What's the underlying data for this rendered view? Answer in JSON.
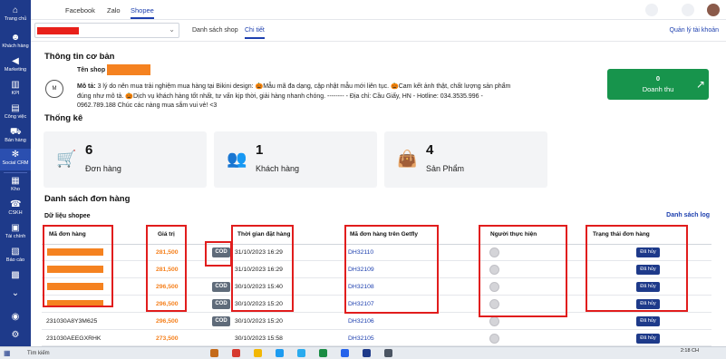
{
  "sidebar": {
    "items": [
      {
        "label": "Trang chủ",
        "icon": "home-icon"
      },
      {
        "label": "Khách hàng",
        "icon": "customers-icon"
      },
      {
        "label": "Marketing",
        "icon": "megaphone-icon"
      },
      {
        "label": "KPI",
        "icon": "chart-icon"
      },
      {
        "label": "Công việc",
        "icon": "briefcase-icon"
      },
      {
        "label": "Bán hàng",
        "icon": "cart-icon"
      },
      {
        "label": "Social CRM",
        "icon": "social-icon"
      },
      {
        "label": "Kho",
        "icon": "warehouse-icon"
      },
      {
        "label": "CSKH",
        "icon": "support-icon"
      },
      {
        "label": "Tài chính",
        "icon": "finance-icon"
      },
      {
        "label": "Báo cáo",
        "icon": "report-icon"
      }
    ]
  },
  "topbar": {
    "tabs": [
      "Facebook",
      "Zalo",
      "Shopee"
    ],
    "active_tab": "Shopee"
  },
  "subbar": {
    "tabs": [
      "Danh sách shop",
      "Chi tiết"
    ],
    "account_link": "Quản lý tài khoản"
  },
  "info": {
    "section_title": "Thông tin cơ bản",
    "shop_label": "Tên shop",
    "desc_label": "Mô tả:",
    "desc_text": "3 lý do nên mua trải nghiệm mua hàng tại Bikini design: 🎃Mẫu mã đa dạng, cập nhật mẫu mới liên tục. 🎃Cam kết ảnh thật, chất lượng sản phẩm đúng như mô tả. 🎃Dịch vụ khách hàng tốt nhất, tư vấn kịp thời, giải hàng nhanh chóng. -------- - Địa chỉ: Cầu Giấy, HN - Hotline: 034.3535.996 - 0962.789.188 Chúc các nàng mua sắm vui vẻ! <3"
  },
  "revenue": {
    "value": "0",
    "label": "Doanh thu"
  },
  "stats": {
    "section_title": "Thống kê",
    "cards": [
      {
        "value": "6",
        "label": "Đơn hàng",
        "icon": "cart-icon"
      },
      {
        "value": "1",
        "label": "Khách hàng",
        "icon": "users-icon"
      },
      {
        "value": "4",
        "label": "Sản Phẩm",
        "icon": "bag-icon"
      }
    ]
  },
  "orders": {
    "section_title": "Danh sách đơn hàng",
    "data_source": "Dữ liệu shopee",
    "list_link": "Danh sách log",
    "columns": [
      "Mã đơn hàng",
      "Giá trị",
      "Thời gian đặt hàng",
      "Mã đơn hàng trên Getfly",
      "Người thực hiện",
      "Trạng thái đơn hàng"
    ],
    "rows": [
      {
        "code": "",
        "value": "281,500",
        "cod": "COD",
        "time": "31/10/2023 16:29",
        "getfly": "DH32110",
        "status": "Đã hủy"
      },
      {
        "code": "",
        "value": "281,500",
        "cod": "",
        "time": "31/10/2023 16:29",
        "getfly": "DH32109",
        "status": "Đã hủy"
      },
      {
        "code": "",
        "value": "296,500",
        "cod": "COD",
        "time": "30/10/2023 15:40",
        "getfly": "DH32108",
        "status": "Đã hủy"
      },
      {
        "code": "",
        "value": "296,500",
        "cod": "COD",
        "time": "30/10/2023 15:20",
        "getfly": "DH32107",
        "status": "Đã hủy"
      },
      {
        "code": "231030A8Y3M625",
        "value": "296,500",
        "cod": "COD",
        "time": "30/10/2023 15:20",
        "getfly": "DH32106",
        "status": "Đã hủy"
      },
      {
        "code": "231030AEEGXRHK",
        "value": "273,500",
        "cod": "",
        "time": "30/10/2023 15:58",
        "getfly": "DH32105",
        "status": "Đã hủy"
      }
    ]
  },
  "taskbar": {
    "search_placeholder": "Tìm kiếm",
    "clock": "2:18 CH"
  }
}
